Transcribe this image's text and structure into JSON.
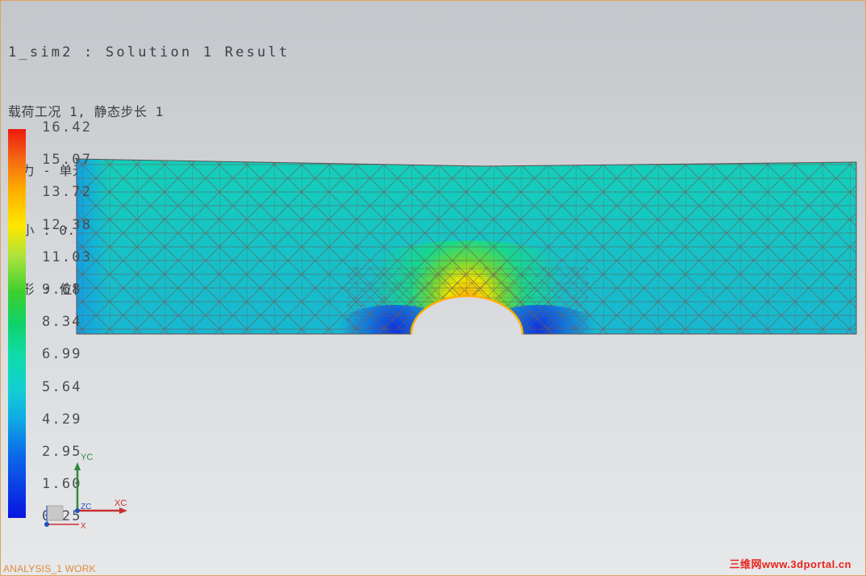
{
  "header": {
    "title": "1_sim2 : Solution 1 Result",
    "load_case": "载荷工况 1, 静态步长 1",
    "stress_type": "应力 - 单元节点, 不平均, Von Mises",
    "range": "最小 : 0.25, 最大 : 16.42, N/mm^2(MPa)",
    "deformation": "变形 : 位移 - 节点的 幅值"
  },
  "legend": {
    "labels": [
      "16.42",
      "15.07",
      "13.72",
      "12.38",
      "11.03",
      "9.68",
      "8.34",
      "6.99",
      "5.64",
      "4.29",
      "2.95",
      "1.60",
      "0.25"
    ]
  },
  "triad": {
    "yc": "YC",
    "xc": "XC",
    "zc": "ZC",
    "x": "X"
  },
  "status_text": "ANALYSIS_1 WORK",
  "watermark": "三维网www.3dportal.cn",
  "colors": {
    "mesh_fill": "#18c4c4",
    "mesh_lines": "#6a5a58",
    "hot_spot": "#ffb400",
    "cool_spot": "#1040e0",
    "frame": "#e1a25a",
    "status": "#e08a3c",
    "watermark": "#e8231b"
  }
}
